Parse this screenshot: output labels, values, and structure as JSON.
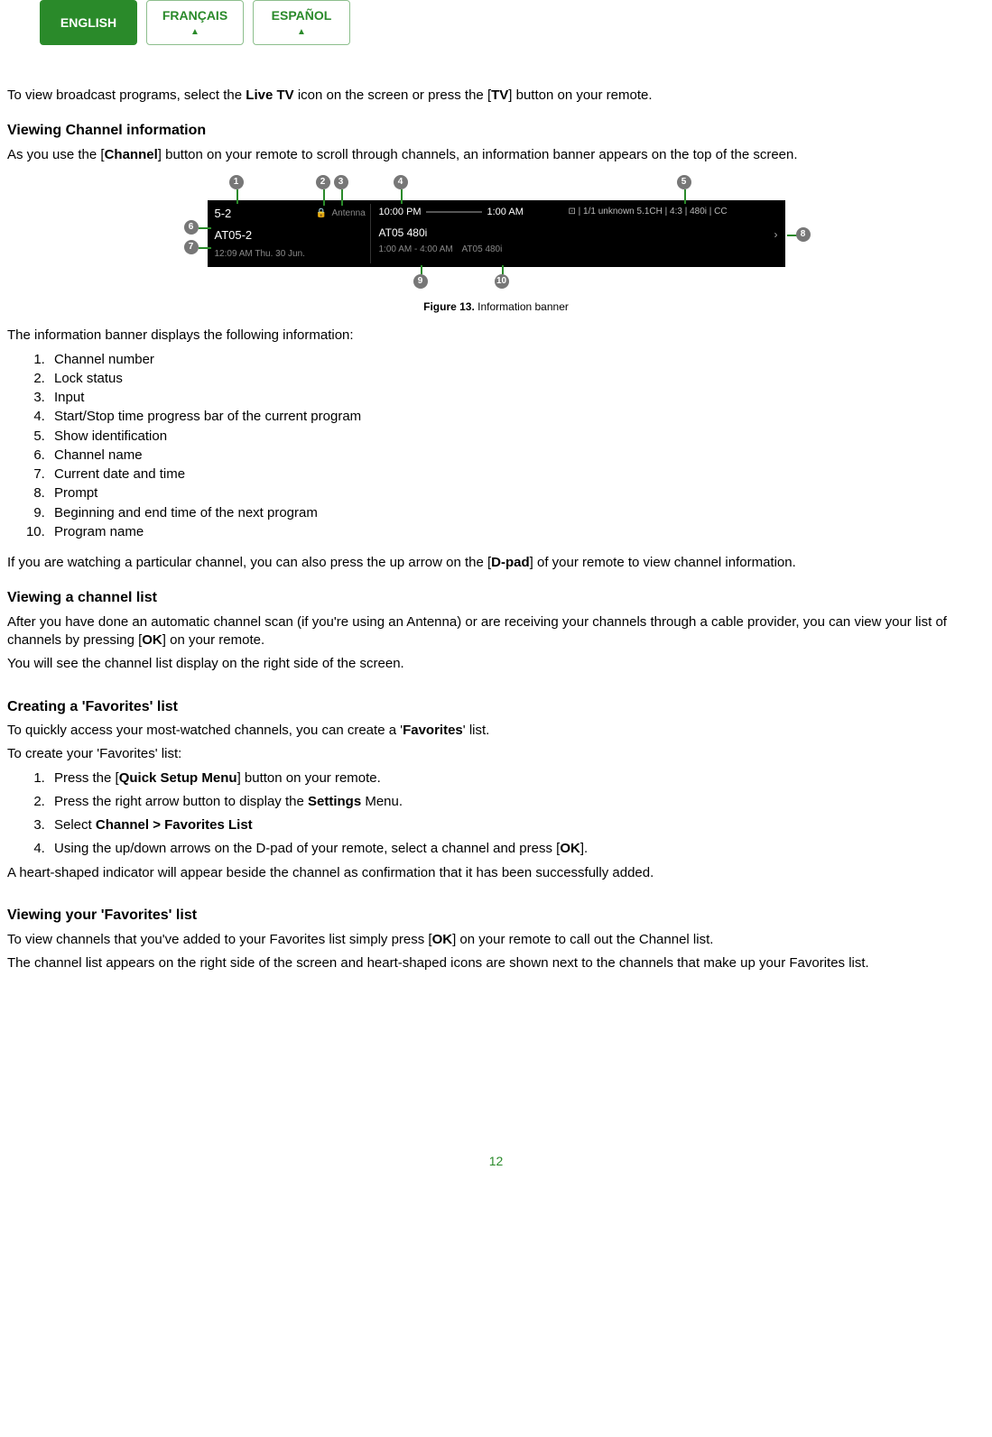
{
  "lang_tabs": {
    "english": "ENGLISH",
    "francais": "FRANÇAIS",
    "espanol": "ESPAÑOL"
  },
  "intro": {
    "pre": "To view broadcast programs, select the ",
    "live_tv": "Live TV",
    "mid": " icon on the screen or press the [",
    "tv": "TV",
    "post": "] button on your remote."
  },
  "sec1": {
    "heading": "Viewing Channel information",
    "line_pre": "As you use the [",
    "channel": "Channel",
    "line_post": "] button on your remote to scroll through channels, an information banner appears on the top of the screen."
  },
  "banner": {
    "ch_num": "5-2",
    "ch_name": "AT05-2",
    "date": "12:09 AM Thu. 30 Jun.",
    "lock_icon": "🔒",
    "input": "Antenna",
    "start_time": "10:00 PM",
    "end_time": "1:00 AM",
    "prog_name": "AT05 480i",
    "next_time": "1:00 AM - 4:00 AM",
    "next_name": "AT05 480i",
    "show_id": "⊡ | 1/1 unknown 5.1CH | 4:3 | 480i | CC",
    "chevron": "›"
  },
  "callouts": {
    "c1": "1",
    "c2": "2",
    "c3": "3",
    "c4": "4",
    "c5": "5",
    "c6": "6",
    "c7": "7",
    "c8": "8",
    "c9": "9",
    "c10": "10"
  },
  "figcap": {
    "bold": "Figure 13.",
    "rest": " Information banner"
  },
  "list_intro": "The information banner displays the following information:",
  "info_items": [
    "Channel number",
    "Lock status",
    "Input",
    "Start/Stop time progress bar of the current program",
    "Show identification",
    "Channel name",
    "Current date and time",
    "Prompt",
    "Beginning and end time of the next program",
    "Program name"
  ],
  "dpad": {
    "pre": "If you are watching a particular channel, you can also press the up arrow on the [",
    "dpad": "D-pad",
    "post": "] of your remote to view channel information."
  },
  "sec2": {
    "heading": "Viewing a channel list",
    "p1_pre": "After you have done an automatic channel scan (if you're using an Antenna) or are receiving your channels through a cable provider, you can view your list of channels by pressing [",
    "ok": "OK",
    "p1_post": "] on your remote.",
    "p2": "You will see the channel list display on the right side of the screen."
  },
  "sec3": {
    "heading": "Creating a 'Favorites' list",
    "p1_pre": "To quickly access your most-watched channels, you can create a '",
    "fav": "Favorites",
    "p1_post": "' list.",
    "p2": "To create your 'Favorites' list:",
    "steps": {
      "s1_pre": "Press the [",
      "s1_b": "Quick Setup Menu",
      "s1_post": "] button on your remote.",
      "s2_pre": "Press the right arrow button to display the ",
      "s2_b": "Settings",
      "s2_post": " Menu.",
      "s3_pre": "Select ",
      "s3_b": "Channel > Favorites List",
      "s4_pre": "Using the up/down arrows on the D-pad of your remote, select a channel and press [",
      "s4_b": "OK",
      "s4_post": "]."
    },
    "p3": "A heart-shaped indicator will appear beside the channel as confirmation that it has been successfully added."
  },
  "sec4": {
    "heading": "Viewing your 'Favorites' list",
    "p1_pre": "To view channels that you've added to your Favorites list simply press [",
    "ok": "OK",
    "p1_post": "] on your remote to call out the Channel list.",
    "p2": "The channel list appears on the right side of the screen and heart-shaped icons are shown next to the channels that make up your Favorites list."
  },
  "page_number": "12"
}
